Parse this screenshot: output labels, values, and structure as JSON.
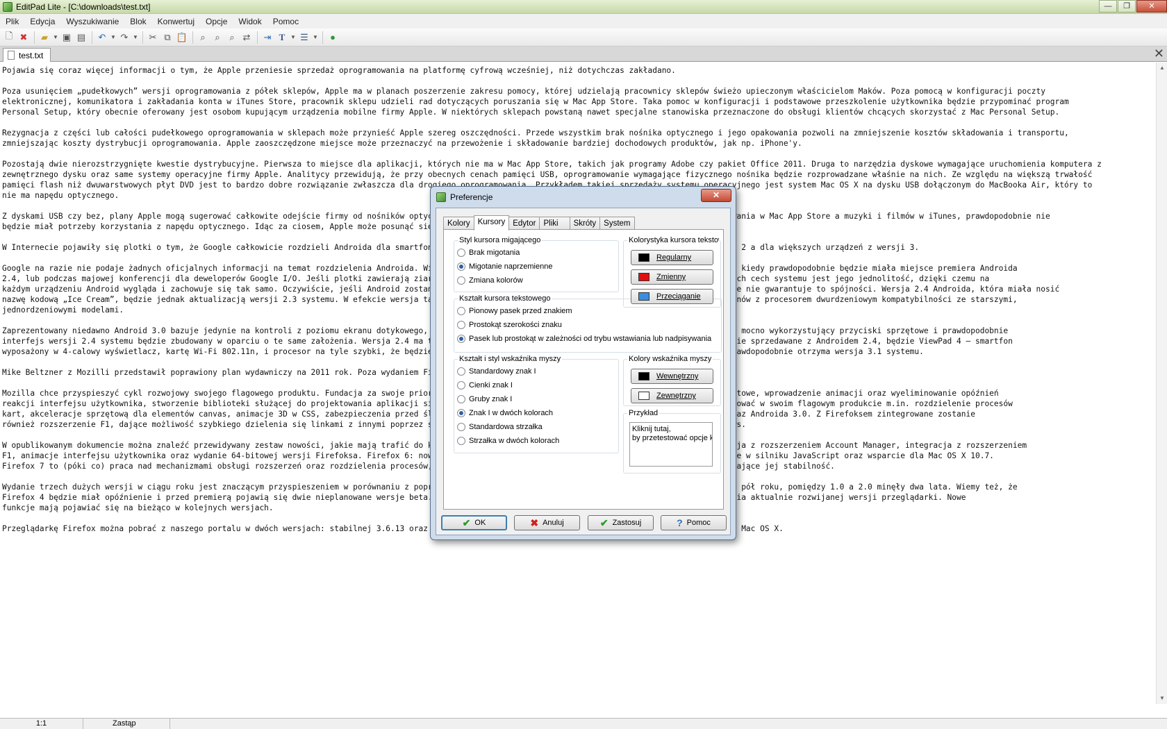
{
  "window": {
    "title": "EditPad Lite - [C:\\downloads\\test.txt]",
    "controls": {
      "minimize": "—",
      "maximize": "❐",
      "close": "✕"
    }
  },
  "menu": [
    "Plik",
    "Edycja",
    "Wyszukiwanie",
    "Blok",
    "Konwertuj",
    "Opcje",
    "Widok",
    "Pomoc"
  ],
  "document_tab": {
    "label": "test.txt",
    "close": "✕"
  },
  "editor_lines": [
    "Pojawia się coraz więcej informacji o tym, że Apple przeniesie sprzedaż oprogramowania na platformę cyfrową wcześniej, niż dotychczas zakładano.",
    "",
    "Poza usunięciem „pudełkowych” wersji oprogramowania z półek sklepów, Apple ma w planach poszerzenie zakresu pomocy, której udzielają pracownicy sklepów świeżo upieczonym właścicielom Maków. Poza pomocą w konfiguracji poczty",
    "elektronicznej, komunikatora i zakładania konta w iTunes Store, pracownik sklepu udzieli rad dotyczących poruszania się w Mac App Store. Taka pomoc w konfiguracji i podstawowe przeszkolenie użytkownika będzie przypominać program",
    "Personal Setup, który obecnie oferowany jest osobom kupującym urządzenia mobilne firmy Apple. W niektórych sklepach powstaną nawet specjalne stanowiska przeznaczone do obsługi klientów chcących skorzystać z Mac Personal Setup.",
    "",
    "Rezygnacja z części lub całości pudełkowego oprogramowania w sklepach może przynieść Apple szereg oszczędności. Przede wszystkim brak nośnika optycznego i jego opakowania pozwoli na zmniejszenie kosztów składowania i transportu,",
    "zmniejszając koszty dystrybucji oprogramowania. Apple zaoszczędzone miejsce może przeznaczyć na przewożenie i składowanie bardziej dochodowych produktów, jak np. iPhone'y.",
    "",
    "Pozostają dwie nierozstrzygnięte kwestie dystrybucyjne. Pierwsza to miejsce dla aplikacji, których nie ma w Mac App Store, takich jak programy Adobe czy pakiet Office 2011. Druga to narzędzia dyskowe wymagające uruchomienia komputera z",
    "zewnętrznego dysku oraz same systemy operacyjne firmy Apple. Analitycy przewidują, że przy obecnych cenach pamięci USB, oprogramowanie wymagające fizycznego nośnika będzie rozprowadzane właśnie na nich. Ze względu na większą trwałość",
    "pamięci flash niż dwuwarstwowych płyt DVD jest to bardzo dobre rozwiązanie zwłaszcza dla drogiego oprogramowania. Przykładem takiej sprzedaży systemu operacyjnego jest system Mac OS X na dysku USB dołączonym do MacBooka Air, który to",
    "nie ma napędu optycznego.",
    "",
    "Z dyskami USB czy bez, plany Apple mogą sugerować całkowite odejście firmy od nośników optycznych, zwłaszcza gdy dołożymy do tego możliwość zakupu oprogramowania w Mac App Store a muzyki i filmów w iTunes, prawdopodobnie nie",
    "będzie miał potrzeby korzystania z napędu optycznego. Idąc za ciosem, Apple może posunąć się do usunięcia napędów optycznych z kolejnych modeli komputerów.",
    "",
    "W Internecie pojawiły się plotki o tym, że Google całkowicie rozdzieli Androida dla smartfonów i tabletów. Wersja dla telefonów miałaby wywodzić się z wersji 2 a dla większych urządzeń z wersji 3.",
    "",
    "Google na razie nie podaje żadnych oficjalnych informacji na temat rozdzielenia Androida. Więcej szczegółów na ten temat można się spodziewać się w kwietniu, kiedy prawdopodobnie będzie miała miejsce premiera Androida",
    "2.4, lub podczas majowej konferencji dla deweloperów Google I/O. Jeśli plotki zawierają ziarno prawdy, może to oznaczać kłopoty dla Androida. Jedną z flagowych cech systemu jest jego jednolitość, dzięki czemu na",
    "każdym urządzeniu Android wygląda i zachowuje się tak samo. Oczywiście, jeśli Android zostanie podzielony, producenci mogą dalej korzystać z identycznych, ale nie gwarantuje to spójności. Wersja 2.4 Androida, która miała nosić",
    "nazwę kodową „Ice Cream”, będzie jednak aktualizacją wersji 2.3 systemu. W efekcie wersja ta ma wprowadzić nowe funkcje i rozwiązania dedykowanych dla telefonów z procesorem dwurdzeniowym kompatybilności ze starszymi,",
    "jednordzeniowymi modelami.",
    "",
    "Zaprezentowany niedawno Android 3.0 bazuje jedynie na kontroli z poziomu ekranu dotykowego, natomiast wersja przeznaczona dla telefonów Android 2.3 to system mocno wykorzystujący przyciski sprzętowe i prawdopodobnie",
    "interfejs wersji 2.4 systemu będzie zbudowany w oparciu o te same założenia. Wersja 2.4 ma trafić również na pierwsze smartfony z tym urządzeniem, które będzie sprzedawane z Androidem 2.4, będzie ViewPad 4 — smartfon",
    "wyposażony w 4-calowy wyświetlacz, kartę Wi-Fi 802.11n, i procesor na tyle szybki, że będzie można na nim uruchomić nową wersję systemu. Nazwę „Ice Cream” prawdopodobnie otrzyma wersja 3.1 systemu.",
    "",
    "Mike Beltzner z Mozilli przedstawił poprawiony plan wydawniczy na 2011 rok. Poza wydaniem Firefoksa 4 planowane są jeszcze trzy wersje przeglądarki.",
    "",
    "Mozilla chce przyspieszyć cykl rozwojowy swojego flagowego produktu. Fundacja za swoje priorytety uznała wprowadzenie nowych funkcji, kiedy tylko będą one gotowe, wprowadzenie animacji oraz wyeliminowanie opóźnień",
    "reakcji interfejsu użytkownika, stworzenie biblioteki służącej do projektowania aplikacji sieciowych z wykorzystaniem HTML5. Ponadto Mozilla chce zaimplementować w swoim flagowym produkcie m.in. rozdzielenie procesów",
    "kart, akceleracje sprzętową dla elementów canvas, animacje 3D w CSS, zabezpieczenia przed śledzeniem i obsługę nowych systemów operacyjnych: Mac OS X 10.7 oraz Androida 3.0. Z Firefoksem zintegrowane zostanie",
    "również rozszerzenie F1, dające możliwość szybkiego dzielenia się linkami z innymi poprzez serwisy społecznościowe, jeszcze w tej wersji Firefoksa dla Windows.",
    "",
    "W opublikowanym dokumencie można znaleźć przewidywany zestaw nowości, jakie mają trafić do kolejnych wersji Firefoksa. Firefox 5 będzie następujący: integracja z rozszerzeniem Account Manager, integracja z rozszerzeniem",
    "F1, animacje interfejsu użytkownika oraz wydanie 64-bitowej wersji Firefoksa. Firefox 6: nowy menedżer rozszerzeń, przebudowany mechanizm cache, optymalizacje w silniku JavaScript oraz wsparcie dla Mac OS X 10.7.",
    "Firefox 7 to (póki co) praca nad mechanizmami obsługi rozszerzeń oraz rozdzielenia procesów, a także drobne poprawki optymalizujące przeglądarkę oraz poprawiające jej stabilność.",
    "",
    "Wydanie trzech dużych wersji w ciągu roku jest znaczącym przyspieszeniem w porównaniu z poprzednimi cyklami — pomiędzy wersjami 3.0 a 4.0 minie około dwóch i pół roku, pomiędzy 1.0 a 2.0 minęły dwa lata. Wiemy też, że",
    "Firefox 4 będzie miał opóźnienie i przed premierą pojawią się dwie nieplanowane wersje beta. Prace nad nowymi funkcjami nie zostaną wstrzymana do czasu wydania aktualnie rozwijanej wersji przeglądarki. Nowe",
    "funkcje mają pojawiać się na bieżąco w kolejnych wersjach.",
    "",
    "Przeglądarkę Firefox można pobrać z naszego portalu w dwóch wersjach: stabilnej 3.6.13 oraz testowej 4.0 beta. Obie dostępne są dla systemów Windows, Linux i Mac OS X."
  ],
  "status": {
    "position": "1:1",
    "mode": "Zastąp"
  },
  "dialog": {
    "title": "Preferencje",
    "close": "✕",
    "tabs": [
      "Kolory",
      "Kursory",
      "Edytor",
      "Pliki",
      "Skróty",
      "System"
    ],
    "blink_group": {
      "label": "Styl kursora migającego",
      "options": [
        "Brak migotania",
        "Migotanie naprzemienne",
        "Zmiana kolorów"
      ]
    },
    "shape_group": {
      "label": "Kształt kursora tekstowego",
      "options": [
        "Pionowy pasek przed znakiem",
        "Prostokąt szerokości znaku",
        "Pasek lub prostokąt w zależności od trybu wstawiania lub nadpisywania"
      ]
    },
    "color_group": {
      "label": "Kolorystyka kursora tekstowego",
      "buttons": [
        {
          "label": "Regularny",
          "color": "#000000"
        },
        {
          "label": "Zmienny",
          "color": "#e01010"
        },
        {
          "label": "Przeciąganie",
          "color": "#3a8ee0"
        }
      ]
    },
    "mouse_group": {
      "label": "Kształt i styl wskaźnika myszy",
      "options": [
        "Standardowy znak I",
        "Cienki znak I",
        "Gruby znak I",
        "Znak I w dwóch kolorach",
        "Standardowa strzałka",
        "Strzałka w dwóch kolorach"
      ]
    },
    "mouse_color_group": {
      "label": "Kolory wskaźnika myszy",
      "buttons": [
        {
          "label": "Wewnętrzny",
          "color": "#000000"
        },
        {
          "label": "Zewnętrzny",
          "color": "#ffffff"
        }
      ]
    },
    "example_group": {
      "label": "Przykład",
      "text_line1": "Kliknij tutaj,",
      "text_line2": "by przetestować opcje k"
    },
    "buttons": {
      "ok": "OK",
      "cancel": "Anuluj",
      "apply": "Zastosuj",
      "help": "Pomoc"
    }
  }
}
